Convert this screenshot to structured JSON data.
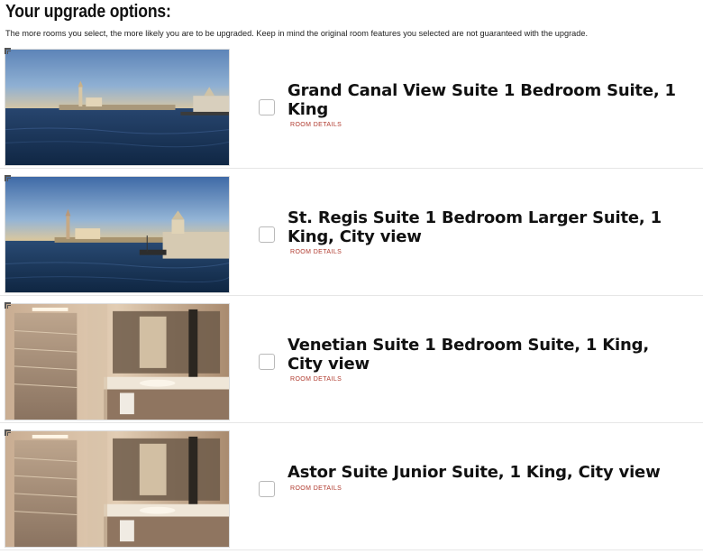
{
  "header": {
    "title": "Your upgrade options:",
    "subtitle": "The more rooms you select, the more likely you are to be upgraded. Keep in mind the original room features you selected are not guaranteed with the upgrade."
  },
  "rooms": [
    {
      "name": "Grand Canal View Suite 1 Bedroom Suite, 1 King",
      "details_label": "ROOM DETAILS",
      "checked": false,
      "image": "canal-view-photo"
    },
    {
      "name": "St. Regis Suite 1 Bedroom Larger Suite, 1 King, City view",
      "details_label": "ROOM DETAILS",
      "checked": false,
      "image": "canal-view-photo"
    },
    {
      "name": "Venetian Suite 1 Bedroom Suite, 1 King, City view",
      "details_label": "ROOM DETAILS",
      "checked": false,
      "image": "bathroom-photo"
    },
    {
      "name": "Astor Suite Junior Suite, 1 King, City view",
      "details_label": "ROOM DETAILS",
      "checked": false,
      "image": "bathroom-photo"
    }
  ],
  "colors": {
    "details_link": "#b03a2e",
    "checkbox_border": "#b9b9b9",
    "divider": "#e6e6e6"
  }
}
